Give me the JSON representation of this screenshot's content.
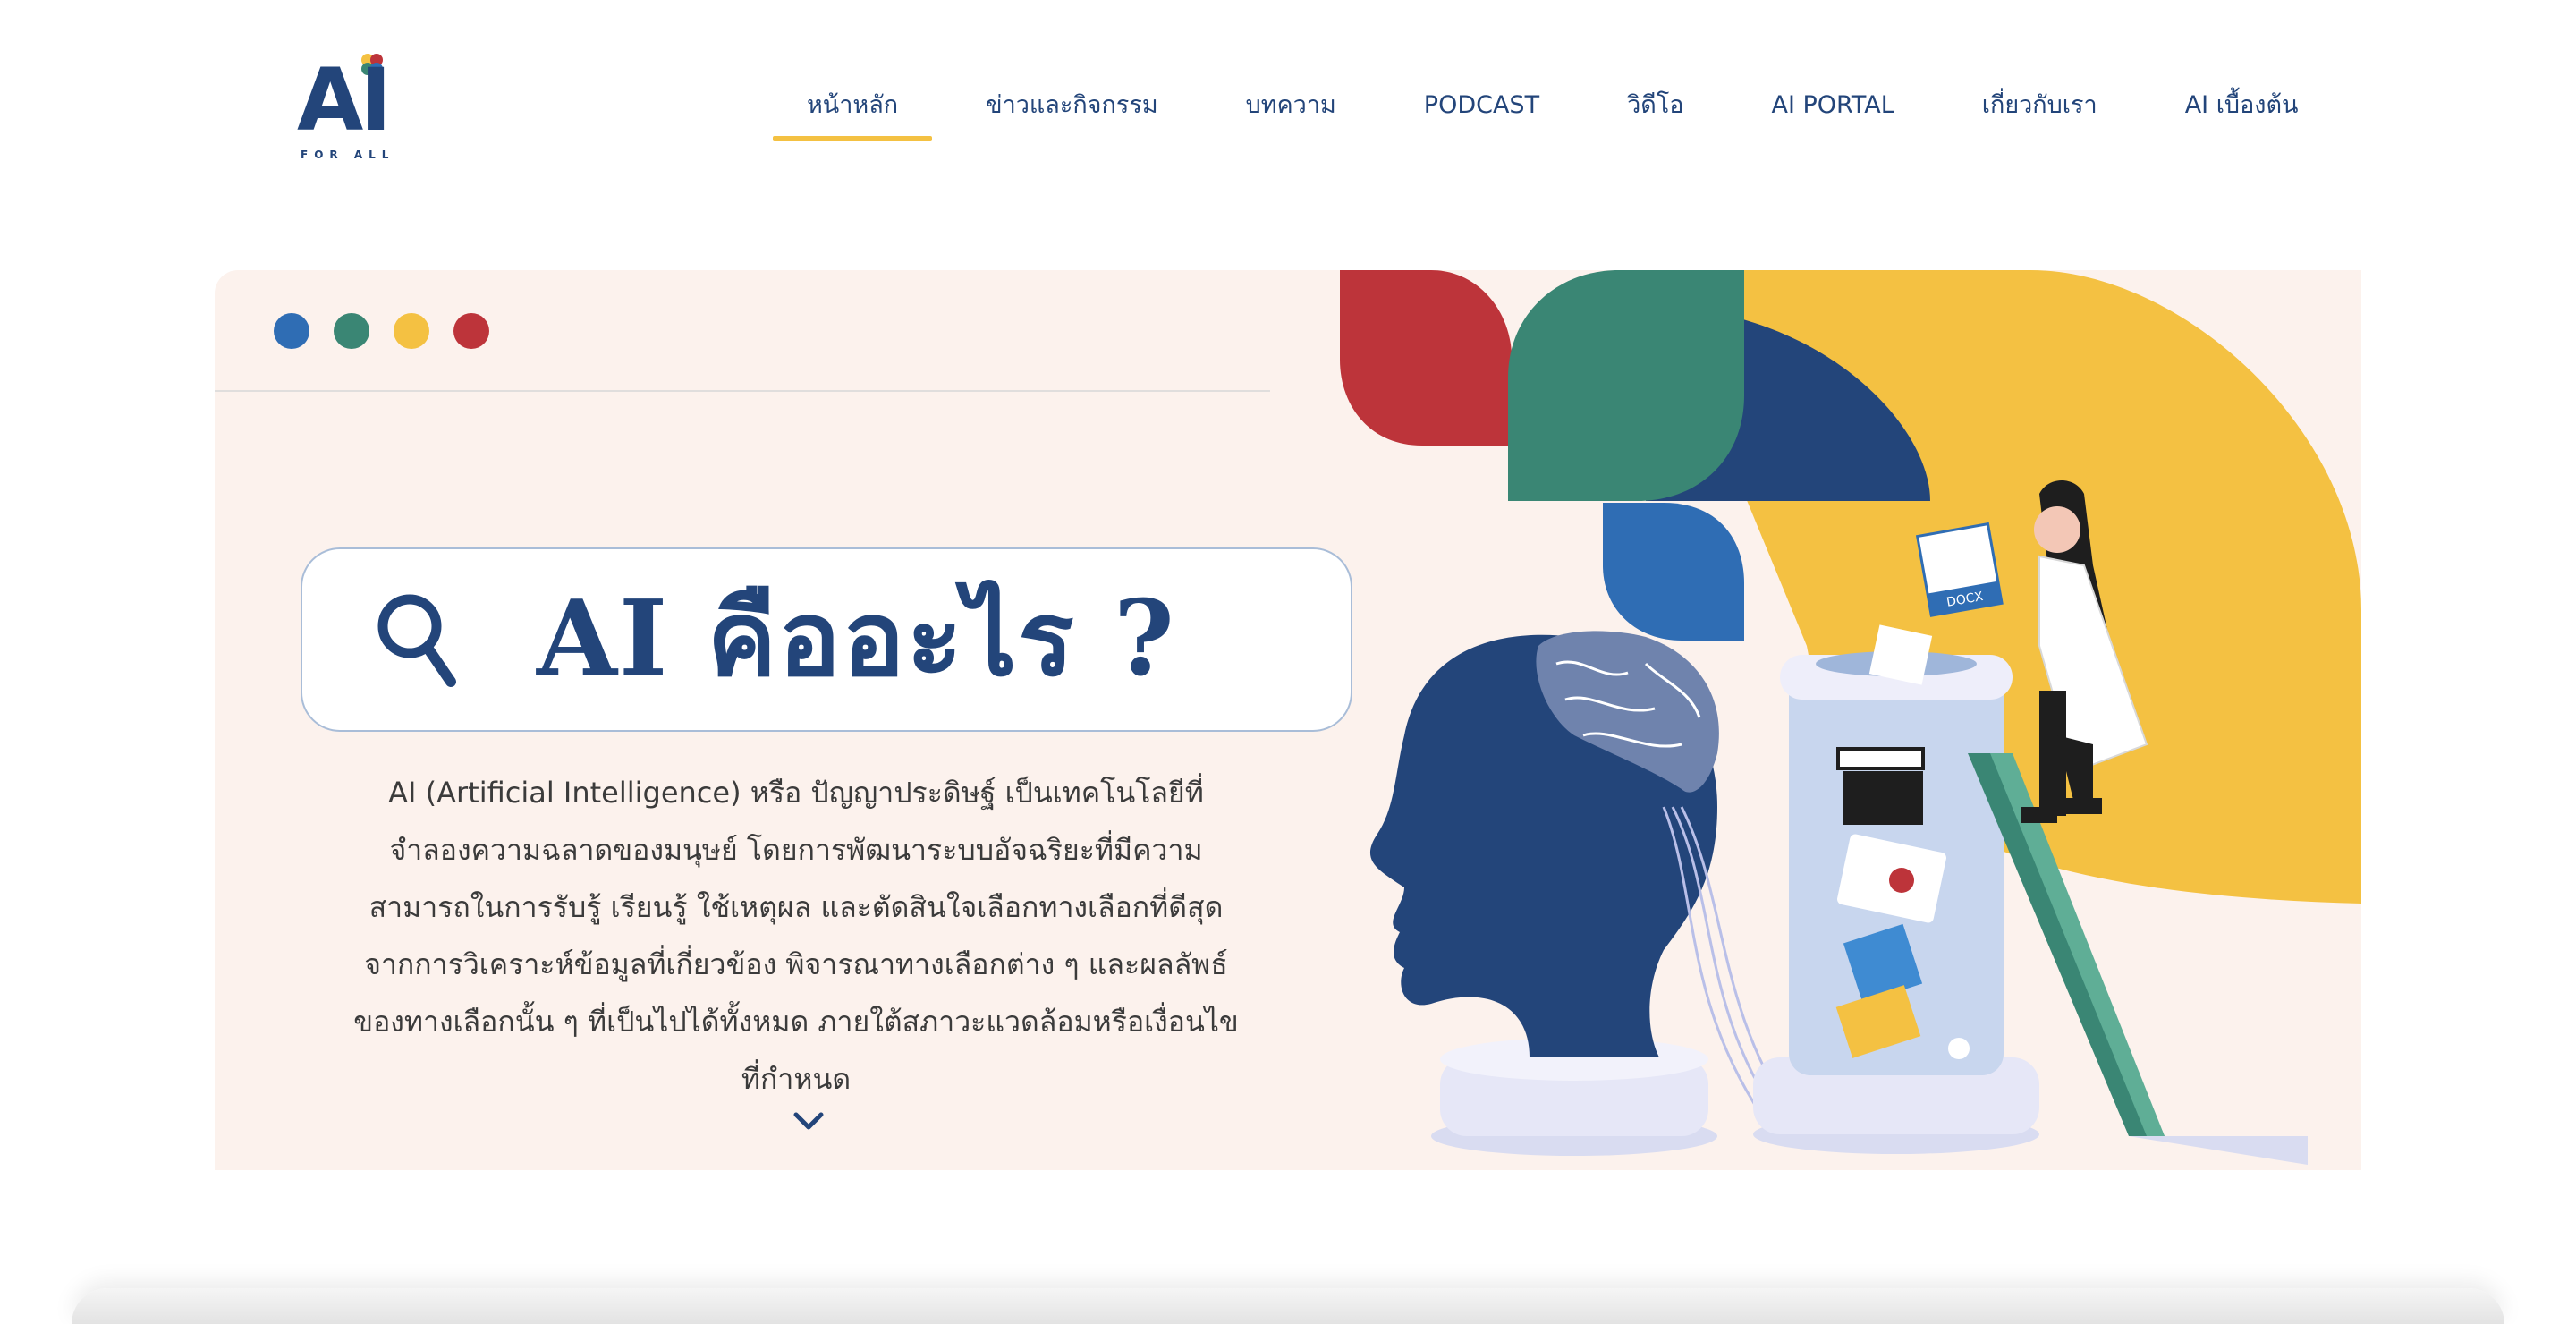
{
  "logo": {
    "main": "AI",
    "sub": "FOR ALL"
  },
  "nav": {
    "items": [
      {
        "label": "หน้าหลัก",
        "active": true
      },
      {
        "label": "ข่าวและกิจกรรม"
      },
      {
        "label": "บทความ"
      },
      {
        "label": "PODCAST"
      },
      {
        "label": "วิดีโอ"
      },
      {
        "label": "AI PORTAL"
      },
      {
        "label": "เกี่ยวกับเรา"
      },
      {
        "label": "AI เบื้องต้น"
      }
    ]
  },
  "colors": {
    "navy": "#23457a",
    "blue": "#2f6db4",
    "green": "#3a8674",
    "yellow": "#f4c142",
    "red": "#bd343a",
    "hero_bg": "#fcf2ed"
  },
  "hero": {
    "title": "AI คืออะไร ?",
    "description": "AI (Artificial Intelligence) หรือ ปัญญาประดิษฐ์ เป็นเทคโนโลยีที่จำลองความฉลาดของมนุษย์ โดยการพัฒนาระบบอัจฉริยะที่มีความสามารถในการรับรู้ เรียนรู้ ใช้เหตุผล และตัดสินใจเลือกทางเลือกที่ดีสุด จากการวิเคราะห์ข้อมูลที่เกี่ยวข้อง พิจารณาทางเลือกต่าง ๆ และผลลัพธ์ของทางเลือกนั้น ๆ ที่เป็นไปได้ทั้งหมด ภายใต้สภาวะแวดล้อมหรือเงื่อนไขที่กำหนด",
    "docx_label": "DOCX"
  },
  "icons": [
    "search-icon",
    "chevron-down-icon",
    "clapperboard-icon",
    "video-play-icon",
    "image-icon",
    "folder-icon",
    "document-icon"
  ]
}
